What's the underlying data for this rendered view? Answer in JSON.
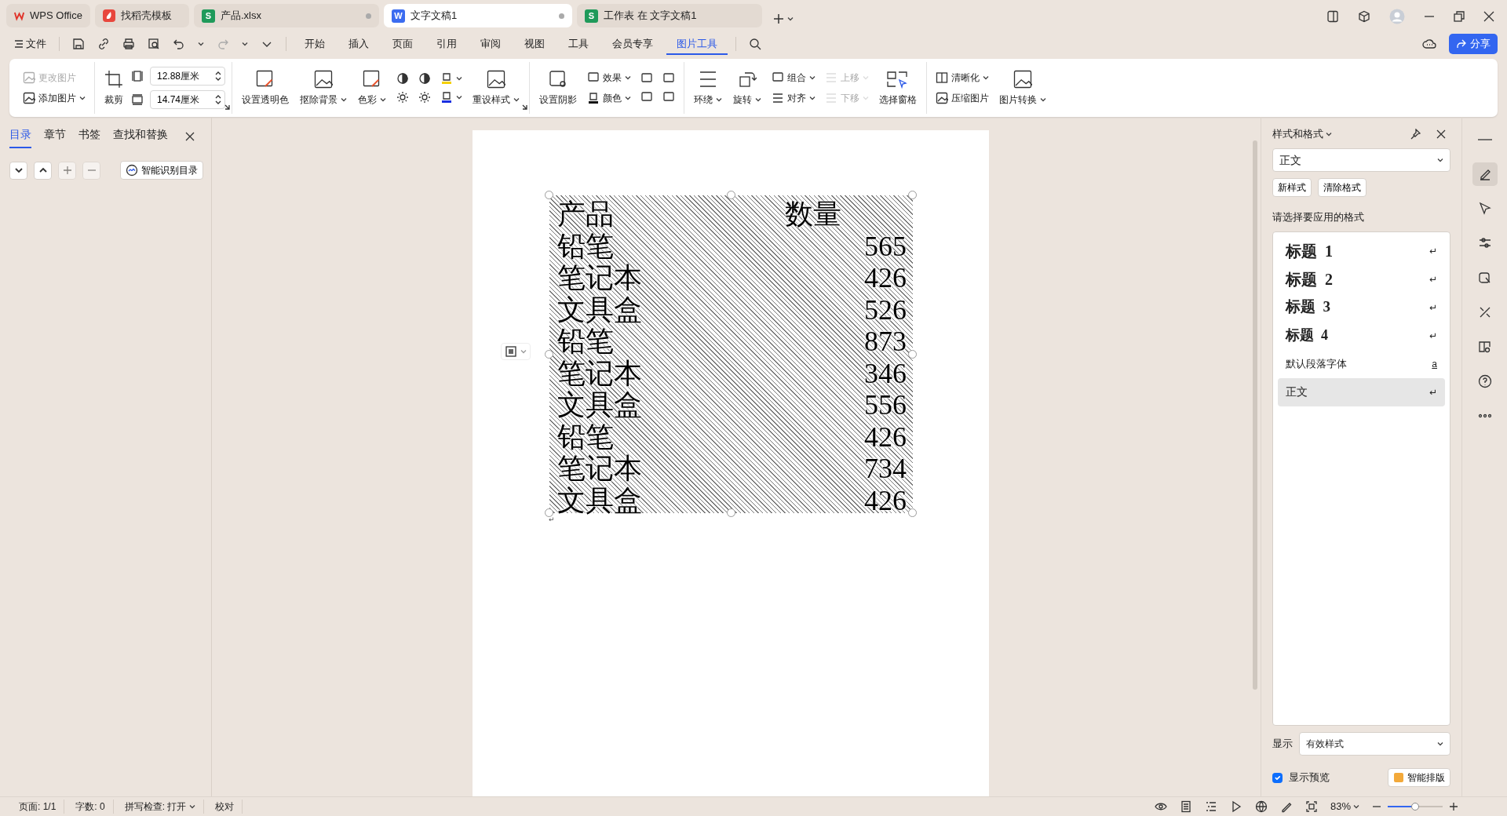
{
  "tabs": [
    {
      "label": "WPS Office",
      "kind": "home",
      "selected": false,
      "unsaved": false
    },
    {
      "label": "找稻壳模板",
      "kind": "docer",
      "selected": false,
      "unsaved": false
    },
    {
      "label": "产品.xlsx",
      "kind": "sheet",
      "badge": "S",
      "selected": false,
      "unsaved": true
    },
    {
      "label": "文字文稿1",
      "kind": "writer",
      "badge": "W",
      "selected": true,
      "unsaved": true
    },
    {
      "label": "工作表 在 文字文稿1",
      "kind": "sheet",
      "badge": "S",
      "selected": false,
      "unsaved": false
    }
  ],
  "file_menu": "文件",
  "ribbon_tabs": [
    {
      "label": "开始",
      "selected": false
    },
    {
      "label": "插入",
      "selected": false
    },
    {
      "label": "页面",
      "selected": false
    },
    {
      "label": "引用",
      "selected": false
    },
    {
      "label": "审阅",
      "selected": false
    },
    {
      "label": "视图",
      "selected": false
    },
    {
      "label": "工具",
      "selected": false
    },
    {
      "label": "会员专享",
      "selected": false
    },
    {
      "label": "图片工具",
      "selected": true
    }
  ],
  "share_button": "分享",
  "ribbon": {
    "groups": [
      {
        "launcher": false,
        "columns": [
          {
            "kind": "stack",
            "items": [
              {
                "label": "更改图片",
                "disabled": true,
                "dropdown": false
              },
              {
                "label": "添加图片",
                "disabled": false,
                "dropdown": true
              }
            ]
          }
        ]
      },
      {
        "launcher": true,
        "columns": [
          {
            "kind": "large",
            "label": "裁剪",
            "dropdown": false
          },
          {
            "kind": "spin",
            "items": [
              {
                "value": "12.88厘米"
              },
              {
                "value": "14.74厘米"
              }
            ]
          }
        ]
      },
      {
        "launcher": true,
        "columns": [
          {
            "kind": "large",
            "label": "设置透明色",
            "dropdown": false
          },
          {
            "kind": "large",
            "label": "抠除背景",
            "dropdown": true
          },
          {
            "kind": "large",
            "label": "色彩",
            "dropdown": true
          },
          {
            "kind": "stack",
            "items": [
              {
                "disabled": false,
                "dropdown": false
              },
              {
                "disabled": false,
                "dropdown": false
              }
            ]
          },
          {
            "kind": "stack",
            "items": [
              {
                "disabled": false,
                "dropdown": false
              },
              {
                "disabled": false,
                "dropdown": false
              }
            ]
          },
          {
            "kind": "stack",
            "items": [
              {
                "disabled": false,
                "dropdown": true
              },
              {
                "disabled": false,
                "dropdown": true
              }
            ]
          },
          {
            "kind": "large",
            "label": "重设样式",
            "dropdown": true
          }
        ]
      },
      {
        "launcher": false,
        "columns": [
          {
            "kind": "large",
            "label": "设置阴影",
            "dropdown": false
          },
          {
            "kind": "stack",
            "items": [
              {
                "label": "效果",
                "disabled": false,
                "dropdown": true
              },
              {
                "label": "颜色",
                "disabled": false,
                "dropdown": true
              }
            ]
          },
          {
            "kind": "stack",
            "items": [
              {
                "disabled": false,
                "dropdown": false
              },
              {
                "disabled": false,
                "dropdown": false
              }
            ]
          },
          {
            "kind": "stack",
            "items": [
              {
                "disabled": false,
                "dropdown": false
              },
              {
                "disabled": false,
                "dropdown": false
              }
            ]
          }
        ]
      },
      {
        "launcher": false,
        "columns": [
          {
            "kind": "large",
            "label": "环绕",
            "dropdown": true
          },
          {
            "kind": "large",
            "label": "旋转",
            "dropdown": true
          },
          {
            "kind": "stack",
            "items": [
              {
                "label": "组合",
                "disabled": false,
                "dropdown": true
              },
              {
                "label": "对齐",
                "disabled": false,
                "dropdown": true
              }
            ]
          },
          {
            "kind": "stack",
            "items": [
              {
                "label": "上移",
                "disabled": true,
                "dropdown": true
              },
              {
                "label": "下移",
                "disabled": true,
                "dropdown": true
              }
            ]
          },
          {
            "kind": "large",
            "label": "选择窗格",
            "dropdown": false
          }
        ]
      },
      {
        "launcher": false,
        "columns": [
          {
            "kind": "stack",
            "items": [
              {
                "label": "清晰化",
                "disabled": false,
                "dropdown": true
              },
              {
                "label": "压缩图片",
                "disabled": false,
                "dropdown": false
              }
            ]
          },
          {
            "kind": "large",
            "label": "图片转换",
            "dropdown": true
          }
        ]
      }
    ]
  },
  "nav_panel": {
    "tabs": [
      {
        "label": "目录",
        "selected": true
      },
      {
        "label": "章节",
        "selected": false
      },
      {
        "label": "书签",
        "selected": false
      },
      {
        "label": "查找和替换",
        "selected": false
      }
    ],
    "buttons": [
      {
        "kind": "down",
        "disabled": false
      },
      {
        "kind": "up",
        "disabled": false
      },
      {
        "kind": "plus",
        "disabled": true
      },
      {
        "kind": "minus",
        "disabled": true
      }
    ],
    "smart_button": "智能识别目录"
  },
  "document": {
    "image_rows": [
      {
        "kind": "header",
        "name": "产品",
        "value": "数量"
      },
      {
        "kind": "data",
        "name": "铅笔",
        "value": "565"
      },
      {
        "kind": "data",
        "name": "笔记本",
        "value": "426"
      },
      {
        "kind": "data",
        "name": "文具盒",
        "value": "526"
      },
      {
        "kind": "data",
        "name": "铅笔",
        "value": "873"
      },
      {
        "kind": "data",
        "name": "笔记本",
        "value": "346"
      },
      {
        "kind": "data",
        "name": "文具盒",
        "value": "556"
      },
      {
        "kind": "data",
        "name": "铅笔",
        "value": "426"
      },
      {
        "kind": "data",
        "name": "笔记本",
        "value": "734"
      },
      {
        "kind": "data",
        "name": "文具盒",
        "value": "426"
      }
    ],
    "paragraph_mark": "↵"
  },
  "styles_panel": {
    "title": "样式和格式",
    "current_style": "正文",
    "buttons": [
      "新样式",
      "清除格式"
    ],
    "prompt": "请选择要应用的格式",
    "styles": [
      {
        "label": "标题  1",
        "kind": "heading1",
        "mark": "↵",
        "selected": false
      },
      {
        "label": "标题  2",
        "kind": "heading2",
        "mark": "↵",
        "selected": false
      },
      {
        "label": "标题  3",
        "kind": "heading3",
        "mark": "↵",
        "selected": false
      },
      {
        "label": "标题  4",
        "kind": "heading4",
        "mark": "↵",
        "selected": false
      },
      {
        "label": "默认段落字体",
        "kind": "character",
        "mark": "a",
        "selected": false
      },
      {
        "label": "正文",
        "kind": "body",
        "mark": "↵",
        "selected": true
      }
    ],
    "show_label": "显示",
    "show_value": "有效样式",
    "preview": {
      "label": "显示预览",
      "checked": true
    },
    "smart_button": "智能排版"
  },
  "status_bar": {
    "items": [
      {
        "label": "页面: 1/1",
        "dropdown": false
      },
      {
        "label": "字数: 0",
        "dropdown": false
      },
      {
        "label": "拼写检查: 打开",
        "dropdown": true
      },
      {
        "label": "校对",
        "dropdown": false
      }
    ],
    "zoom": "83%",
    "zoom_slider": {
      "level": 0.5
    }
  }
}
